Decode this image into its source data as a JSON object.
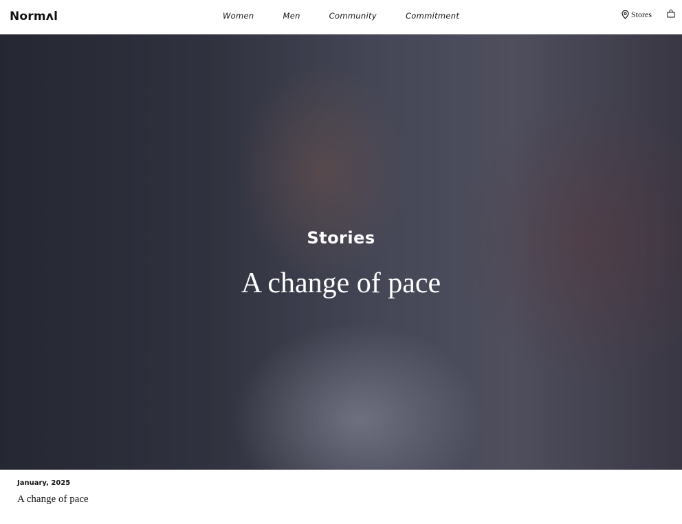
{
  "brand": {
    "logo_text": "Normʌl"
  },
  "nav": {
    "items": [
      {
        "label": "Women"
      },
      {
        "label": "Men"
      },
      {
        "label": "Community"
      },
      {
        "label": "Commitment"
      }
    ]
  },
  "header": {
    "stores_label": "Stores"
  },
  "hero": {
    "kicker": "Stories",
    "title": "A change of pace"
  },
  "article": {
    "date": "January, 2025",
    "title": "A change of pace"
  }
}
